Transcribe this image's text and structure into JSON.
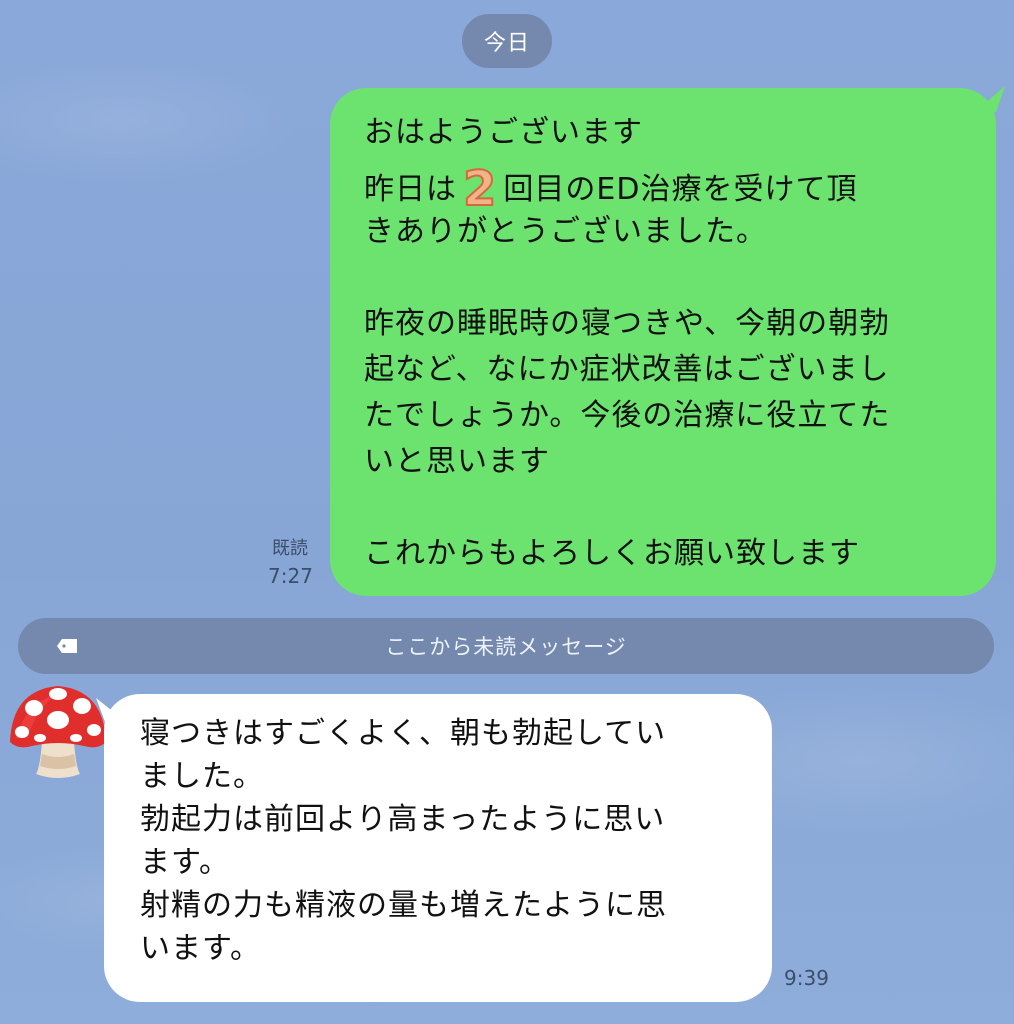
{
  "header": {
    "date_label": "今日"
  },
  "outgoing_message": {
    "lines": [
      "おはようございます",
      "昨日は",
      "回目のED治療を受けて頂",
      "きありがとうございました。",
      "昨夜の睡眠時の寝つきや、今朝の朝勃",
      "起など、なにか症状改善はございまし",
      "たでしょうか。今後の治療に役立てた",
      "いと思います",
      "これからもよろしくお願い致します"
    ],
    "number_emoji": "2",
    "read_status": "既読",
    "time": "7:27",
    "bubble_color": "#6de36f"
  },
  "unread_divider": {
    "label": "ここから未読メッセージ",
    "icon": "tag-icon"
  },
  "incoming_message": {
    "avatar": "mushroom-icon",
    "lines": [
      "寝つきはすごくよく、朝も勃起してい",
      "ました。",
      "勃起力は前回より高まったように思い",
      "ます。",
      "射精の力も精液の量も増えたように思",
      "います。"
    ],
    "time": "9:39",
    "bubble_color": "#ffffff"
  },
  "theme": {
    "background": "#8aa8d8",
    "pill_background": "#7489ad"
  }
}
